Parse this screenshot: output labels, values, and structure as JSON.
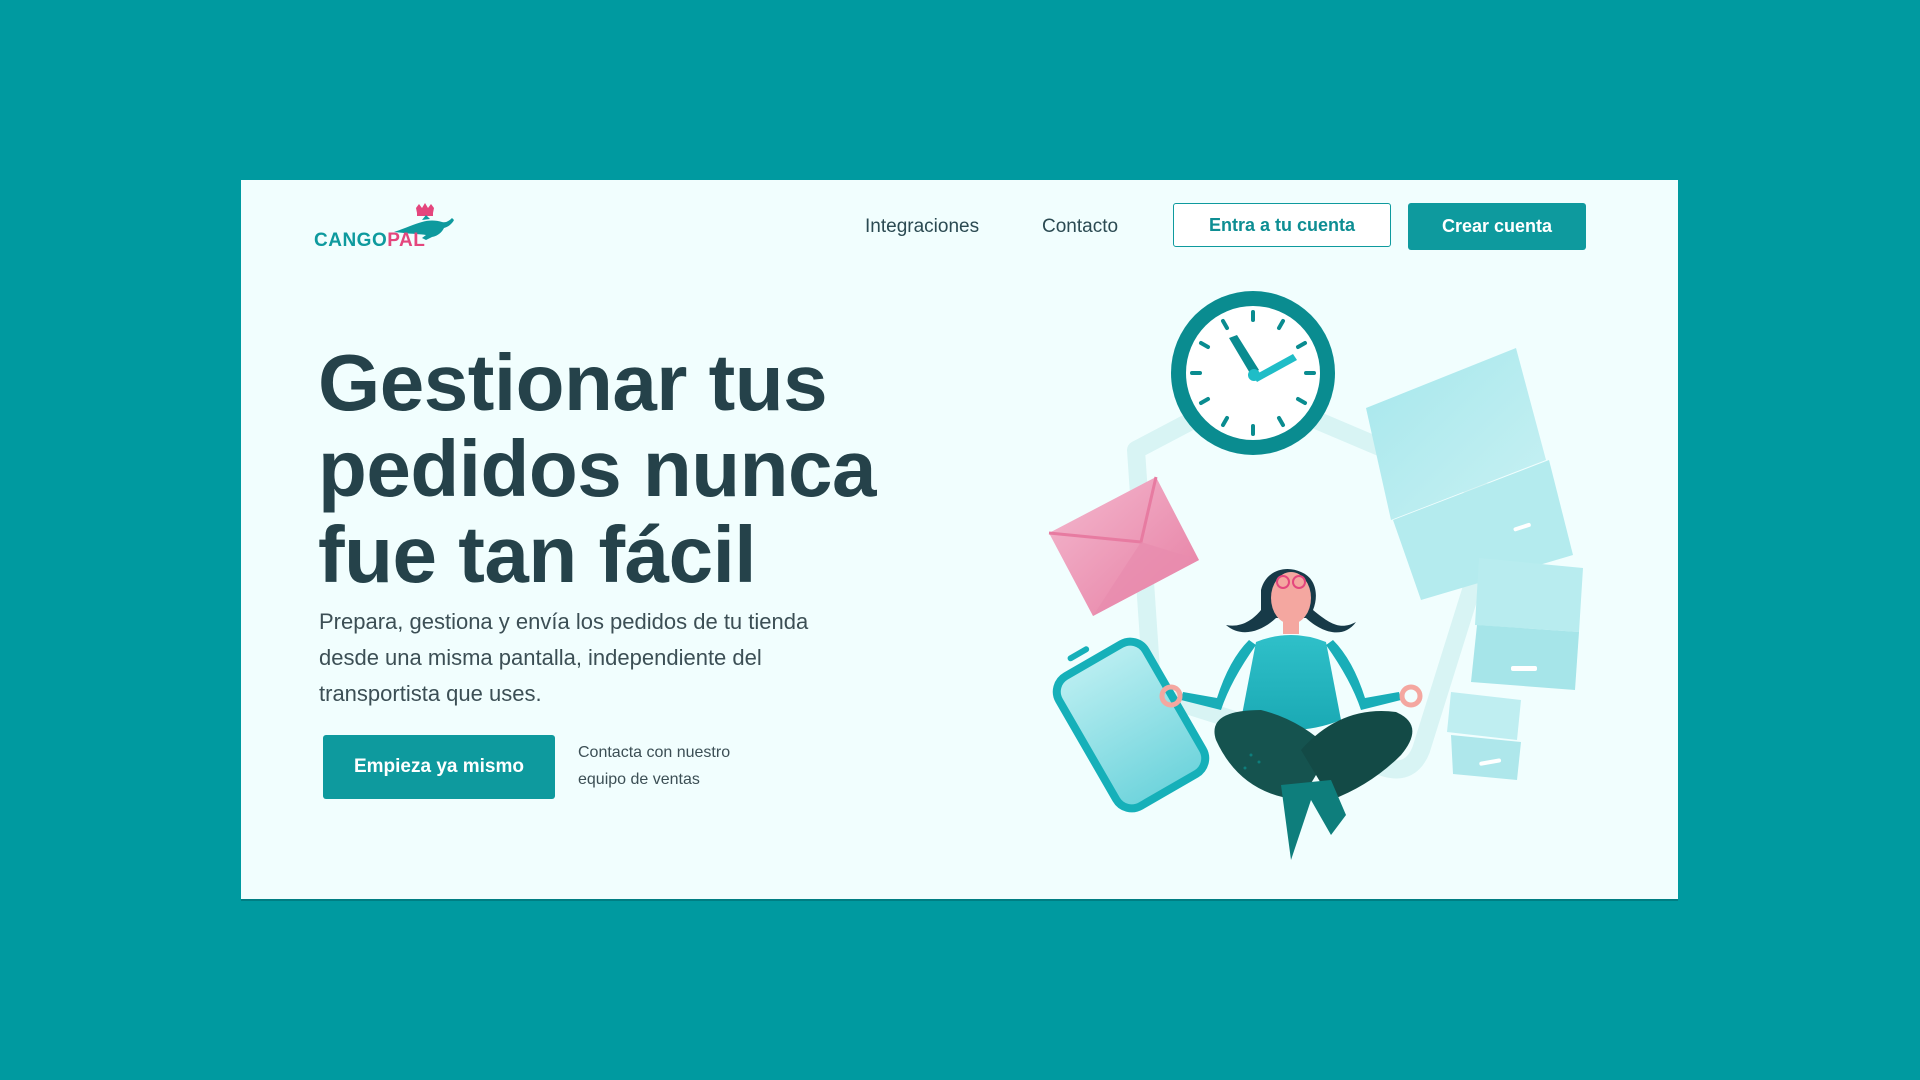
{
  "header": {
    "logo": {
      "part1": "CANGO",
      "part2": "PAL"
    },
    "nav": [
      {
        "label": "Integraciones"
      },
      {
        "label": "Contacto"
      }
    ],
    "login_label": "Entra a tu cuenta",
    "signup_label": "Crear cuenta"
  },
  "hero": {
    "headline_lines": [
      "Gestionar tus",
      "pedidos nunca",
      "fue tan fácil"
    ],
    "subtitle_lines": [
      "Prepara, gestiona y envía los pedidos de tu tienda",
      "desde una misma pantalla, independiente del",
      "transportista que uses."
    ],
    "cta_label": "Empieza ya mismo",
    "contact_lines": [
      "Contacta con nuestro",
      "equipo de ventas"
    ]
  },
  "colors": {
    "background": "#009aa0",
    "card": "#f1fefe",
    "primary": "#0e9a9e",
    "brand_pink": "#e4467d",
    "heading": "#25424a"
  },
  "icons": [
    "kangaroo-logo-icon",
    "clock-icon",
    "envelope-icon",
    "phone-icon",
    "box-icon"
  ]
}
